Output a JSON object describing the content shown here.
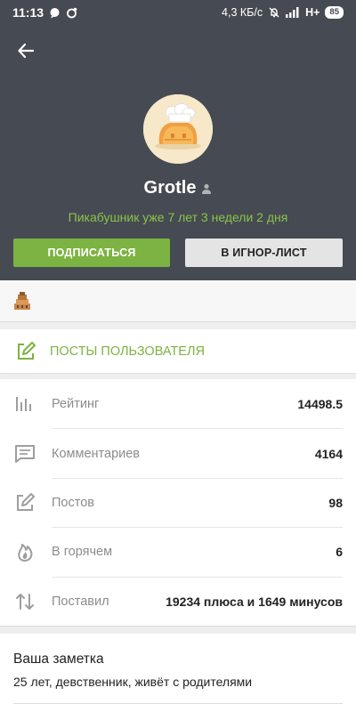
{
  "status_bar": {
    "time": "11:13",
    "network_speed": "4,3 КБ/с",
    "network_type": "H+",
    "battery": "85",
    "icons": [
      "chat-icon",
      "sync-icon",
      "mute-icon",
      "signal-icon"
    ]
  },
  "header": {
    "back_icon": "arrow-left-icon",
    "username": "Grotle",
    "gender_icon": "person-icon",
    "member_since": "Пикабушник уже 7 лет 3 недели 2 дня",
    "subscribe_label": "ПОДПИСАТЬСЯ",
    "ignore_label": "В ИГНОР-ЛИСТ"
  },
  "awards": {
    "items": [
      "award-medal-icon"
    ]
  },
  "posts_link": {
    "label": "ПОСТЫ ПОЛЬЗОВАТЕЛЯ",
    "icon": "edit-icon"
  },
  "stats": [
    {
      "label": "Рейтинг",
      "value": "14498.5",
      "icon": "chart-icon"
    },
    {
      "label": "Комментариев",
      "value": "4164",
      "icon": "comment-icon"
    },
    {
      "label": "Постов",
      "value": "98",
      "icon": "edit-icon"
    },
    {
      "label": "В горячем",
      "value": "6",
      "icon": "flame-icon"
    },
    {
      "label": "Поставил",
      "value": "19234 плюса и 1649 минусов",
      "icon": "swap-icon"
    }
  ],
  "note": {
    "title": "Ваша заметка",
    "text": "25 лет, девственник, живёт с родителями"
  },
  "colors": {
    "header_bg": "#464a52",
    "accent_green": "#7cb342",
    "since_green": "#8bc34a",
    "ignore_bg": "#e4e4e4"
  }
}
